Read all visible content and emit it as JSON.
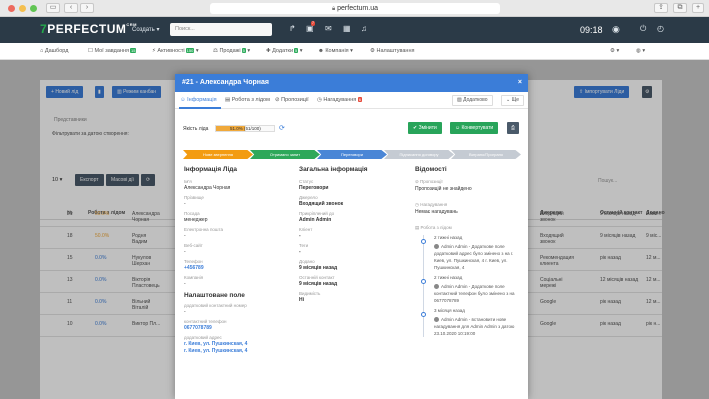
{
  "browser": {
    "url": "perfectum.ua",
    "traffic_colors": [
      "#ed6a5e",
      "#f4bf4f",
      "#61c554"
    ]
  },
  "topnav": {
    "logo_mark": "7",
    "logo_text": "PERFECTUM",
    "logo_sup": "CRM",
    "create": "Создать",
    "search_placeholder": "Поиск...",
    "notif_badge": "7",
    "clock": "09:18"
  },
  "menu": {
    "items": [
      {
        "label": "Дашборд",
        "badge": ""
      },
      {
        "label": "Мої завдання",
        "badge": "15"
      },
      {
        "label": "Активності",
        "badge": "150"
      },
      {
        "label": "Продажі",
        "badge": "5"
      },
      {
        "label": "Додатки",
        "badge": "5"
      },
      {
        "label": "Компанія",
        "badge": ""
      },
      {
        "label": "Налаштування",
        "badge": ""
      }
    ]
  },
  "background": {
    "new_lead": "Новий лід",
    "kanban": "Режим канбан",
    "import": "Імпортувати Ліди",
    "filter_placeholder": "Представники",
    "filter_label": "Фільтрувати за датою створення:",
    "page_size": "10",
    "export": "Експорт",
    "bulk": "Масові дії",
    "search_hint": "Пошук...",
    "col_num": "№",
    "col_work": "Робота з лідом",
    "col_source": "Джерела",
    "col_last": "Останній контакт",
    "col_added": "Додано",
    "rows": [
      {
        "id": "21",
        "pct": "50.0%",
        "name": "Александра Чорная",
        "src": "Входящий звонок",
        "last": "9 місяців назад",
        "added": "9 міс..."
      },
      {
        "id": "18",
        "pct": "50.0%",
        "name": "Родня Вадим",
        "src": "Входящий звонок",
        "last": "9 місяців назад",
        "added": "9 міс..."
      },
      {
        "id": "15",
        "pct": "0.0%",
        "name": "Нукулов Шерхан",
        "src": "Рекомендация клиента",
        "last": "рік назад",
        "added": "12 м..."
      },
      {
        "id": "13",
        "pct": "0.0%",
        "name": "Вікторія Пластовець",
        "src": "Соціальні мережі",
        "last": "12 місяців назад",
        "added": "12 м..."
      },
      {
        "id": "11",
        "pct": "0.0%",
        "name": "Вільний Віталій",
        "src": "Google",
        "last": "рік назад",
        "added": "12 м..."
      },
      {
        "id": "10",
        "pct": "0.0%",
        "name": "Виктор Пл...",
        "src": "Google",
        "last": "рік назад",
        "added": "рік н..."
      }
    ]
  },
  "modal": {
    "title": "#21 - Александра Чорная",
    "close": "×",
    "tabs": [
      {
        "label": "Інформація"
      },
      {
        "label": "Робота з лідом"
      },
      {
        "label": "Пропозиції"
      },
      {
        "label": "Нагадування",
        "badge": "6"
      }
    ],
    "more_btn": "Додатково",
    "chevron": "Ще",
    "progress_label": "Якість ліда",
    "progress_fraction": 0.5,
    "progress_text": "51.0% (51/100)",
    "convert_btn": "Змінити",
    "customer_btn": "Конвертувати",
    "stages": [
      {
        "label": "Нове звернення",
        "color": "#f39c12"
      },
      {
        "label": "Отримано запит",
        "color": "#2ea85a"
      },
      {
        "label": "Переговори",
        "color": "#4a86d6"
      },
      {
        "label": "Підписання договору",
        "color": "#c5cbd3"
      },
      {
        "label": "Виграно/Програно",
        "color": "#c5cbd3"
      }
    ],
    "lead_info": {
      "heading": "Інформація Ліда",
      "fields": [
        {
          "label": "Ім'я",
          "value": "Александра Чорная"
        },
        {
          "label": "Прізвище",
          "value": "-"
        },
        {
          "label": "Посада",
          "value": "менеджер"
        },
        {
          "label": "Електронна пошта",
          "value": "-"
        },
        {
          "label": "Веб-сайт",
          "value": "-"
        },
        {
          "label": "Телефон",
          "value": "+456789"
        },
        {
          "label": "Компанія",
          "value": "-"
        }
      ]
    },
    "custom": {
      "heading": "Налаштоване поле",
      "fields": [
        {
          "label": "додатковий контактний номер",
          "value": "-"
        },
        {
          "label": "контактний телефон",
          "value": "0677078789"
        },
        {
          "label": "додатковий адрес",
          "value": "г. Киев, ул. Пушкинская, 4"
        },
        {
          "label": "",
          "value": "г. Киев, ул. Пушкинская, 4"
        }
      ]
    },
    "general": {
      "heading": "Загальна інформація",
      "fields": [
        {
          "label": "Статус",
          "value": "Переговори"
        },
        {
          "label": "Джерело",
          "value": "Входящий звонок"
        },
        {
          "label": "Прикріплений до",
          "value": "Admin Admin"
        },
        {
          "label": "Кліент",
          "value": "-"
        },
        {
          "label": "Теги",
          "value": "-"
        },
        {
          "label": "Додано",
          "value": "9 місяців назад"
        },
        {
          "label": "Останній контакт",
          "value": "9 місяців назад"
        },
        {
          "label": "Видимість",
          "value": "Ні"
        }
      ]
    },
    "details": {
      "heading": "Відомості",
      "offer_label": "Пропозиції",
      "offer_value": "Пропозицій не знайдено",
      "reminder_label": "Нагадування",
      "reminder_value": "Немає нагадувань",
      "activity_label": "Робота з лідом",
      "events": [
        {
          "when": "2 тижні назад",
          "text": "Admin Admin - Додаткове поле додатковий адрес було змінено з на г. Киев, ул. Пушкинская, 4 г. Киев, ул. Пушкинская, 4"
        },
        {
          "when": "2 тижні назад",
          "text": "Admin Admin - Додаткове поле контактний телефон було змінено з на 0677078789"
        },
        {
          "when": "3 місяця назад",
          "text": "Admin Admin - встановити нове нагадування для Admin Admin з датою 23.10.2020 10:19:00"
        }
      ]
    }
  }
}
